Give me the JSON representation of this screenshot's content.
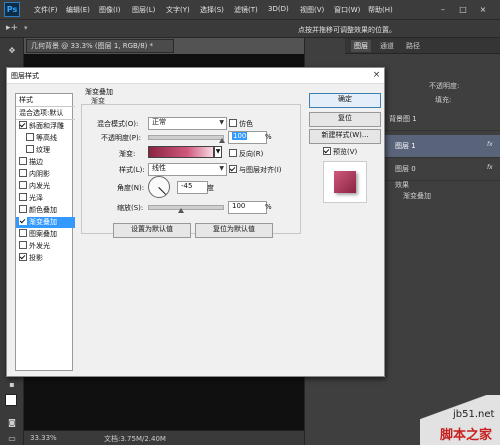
{
  "app": {
    "logo": "Ps",
    "menu": [
      "文件(F)",
      "编辑(E)",
      "图像(I)",
      "图层(L)",
      "文字(Y)",
      "选择(S)",
      "滤镜(T)",
      "3D(D)",
      "视图(V)",
      "窗口(W)",
      "帮助(H)"
    ],
    "window_controls": [
      "–",
      "□",
      "×"
    ]
  },
  "optionsbar": {
    "hint": "点按并拖移可调整效果的位置。"
  },
  "document": {
    "tab_title": "几何背景 @ 33.3% (图层 1, RGB/8) *",
    "zoom": "33.33%",
    "doc_info": "文档:3.75M/2.40M"
  },
  "panels": {
    "tabs": [
      "图层",
      "通道",
      "路径"
    ],
    "fill_label": "不透明度:",
    "fill2_label": "填充:",
    "layers": [
      {
        "name": "背景图 1"
      },
      {
        "name": "图层 1",
        "fx": "fx"
      },
      {
        "name": "图层 0",
        "fx": "fx"
      }
    ],
    "effects_label": "效果",
    "effect_item": "渐变叠加"
  },
  "watermark": {
    "site": "jb51.net",
    "name": "脚本之家"
  },
  "dialog": {
    "title": "图层样式",
    "close": "×",
    "styles_header": "样式",
    "blend_header": "混合选项:默认",
    "styles": [
      {
        "label": "斜面和浮雕",
        "checked": true
      },
      {
        "label": "等高线",
        "checked": false,
        "indent": true
      },
      {
        "label": "纹理",
        "checked": false,
        "indent": true
      },
      {
        "label": "描边",
        "checked": false
      },
      {
        "label": "内阴影",
        "checked": false
      },
      {
        "label": "内发光",
        "checked": false
      },
      {
        "label": "光泽",
        "checked": false
      },
      {
        "label": "颜色叠加",
        "checked": false
      },
      {
        "label": "渐变叠加",
        "checked": true,
        "selected": true
      },
      {
        "label": "图案叠加",
        "checked": false
      },
      {
        "label": "外发光",
        "checked": false
      },
      {
        "label": "投影",
        "checked": true
      }
    ],
    "section_title": "渐变叠加",
    "group_title": "渐变",
    "blend_mode_label": "混合模式(O):",
    "blend_mode_value": "正常",
    "dither_label": "仿色",
    "opacity_label": "不透明度(P):",
    "opacity_value": "100",
    "opacity_level": 1.0,
    "percent": "%",
    "gradient_label": "渐变:",
    "reverse_label": "反向(R)",
    "style_label": "样式(L):",
    "style_value": "线性",
    "align_label": "与图层对齐(I)",
    "angle_label": "角度(N):",
    "angle_value": "-45",
    "degree": "度",
    "scale_label": "缩放(S):",
    "scale_value": "100",
    "scale_level": 0.45,
    "btn_set_default": "设置为默认值",
    "btn_reset_default": "复位为默认值",
    "btn_ok": "确定",
    "btn_reset": "复位",
    "btn_new_style": "新建样式(W)...",
    "preview_label": "预览(V)",
    "gradient_colors": [
      "#8a2442",
      "#d0587c",
      "#f7dbe5"
    ],
    "accent": "#3399ff"
  }
}
